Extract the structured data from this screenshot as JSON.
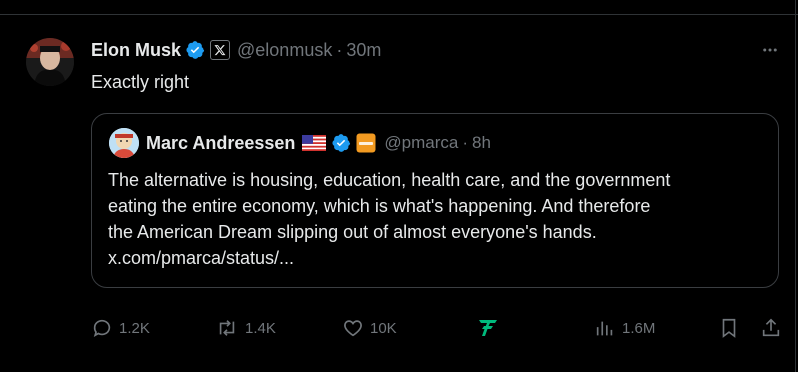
{
  "tweet": {
    "author_name": "Elon Musk",
    "handle": "@elonmusk",
    "separator": "·",
    "time": "30m",
    "text": "Exactly right",
    "avatar_icon": "avatar-image",
    "verified_color": "#1d9bf0"
  },
  "quote": {
    "author_name": "Marc Andreessen",
    "handle": "@pmarca",
    "separator": "·",
    "time": "8h",
    "lines": [
      "The alternative is housing, education, health care, and the government",
      "eating the entire economy, which is what's happening. And therefore",
      "the American Dream slipping out of almost everyone's hands.",
      "x.com/pmarca/status/..."
    ]
  },
  "actions": {
    "replies": "1.2K",
    "reposts": "1.4K",
    "likes": "10K",
    "views": "1.6M",
    "grok_icon": "grok-icon",
    "grok_color": "#00ba7c"
  }
}
